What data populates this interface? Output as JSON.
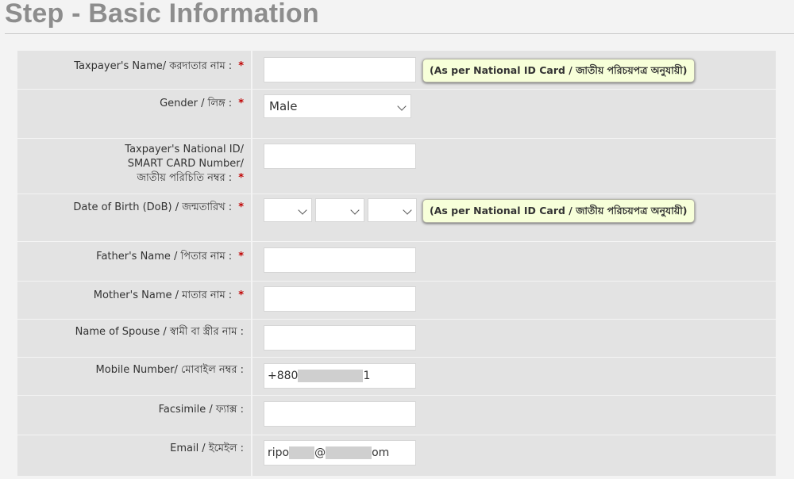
{
  "page": {
    "title": "Step - Basic Information"
  },
  "fields": {
    "taxpayer_name": {
      "label": "Taxpayer's Name/ করদাতার নাম :",
      "value": ""
    },
    "gender": {
      "label": "Gender / লিঙ্গ :",
      "value": "Male"
    },
    "national_id": {
      "label_line1": "Taxpayer's National ID/",
      "label_line2": "SMART CARD Number/",
      "label_line3": "জাতীয় পরিচিতি নম্বর :",
      "value": ""
    },
    "dob": {
      "label": "Date of Birth (DoB) / জন্মতারিখ :",
      "day": "",
      "month": "",
      "year": ""
    },
    "father_name": {
      "label": "Father's Name / পিতার নাম :",
      "value": ""
    },
    "mother_name": {
      "label": "Mother's Name / মাতার নাম :",
      "value": ""
    },
    "spouse_name": {
      "label": "Name of Spouse / স্বামী বা স্ত্রীর নাম :",
      "value": ""
    },
    "mobile": {
      "label": "Mobile Number/ মোবাইল নম্বর :",
      "value_prefix": "+880",
      "value_suffix": "1"
    },
    "fax": {
      "label": "Facsimile / ফ্যাক্স :",
      "value": ""
    },
    "email": {
      "label": "Email / ইমেইল :",
      "value_prefix": "ripo",
      "value_middle": "@",
      "value_suffix": "om"
    }
  },
  "hints": {
    "nid_card": "(As per National ID Card / জাতীয় পরিচয়পত্র অনুযায়ী)"
  },
  "required_marker": "*",
  "colors": {
    "title": "#8d8d8d",
    "required": "#c00000",
    "hint_bg": "#f7ffd9",
    "panel_bg": "#e3e3e3"
  }
}
